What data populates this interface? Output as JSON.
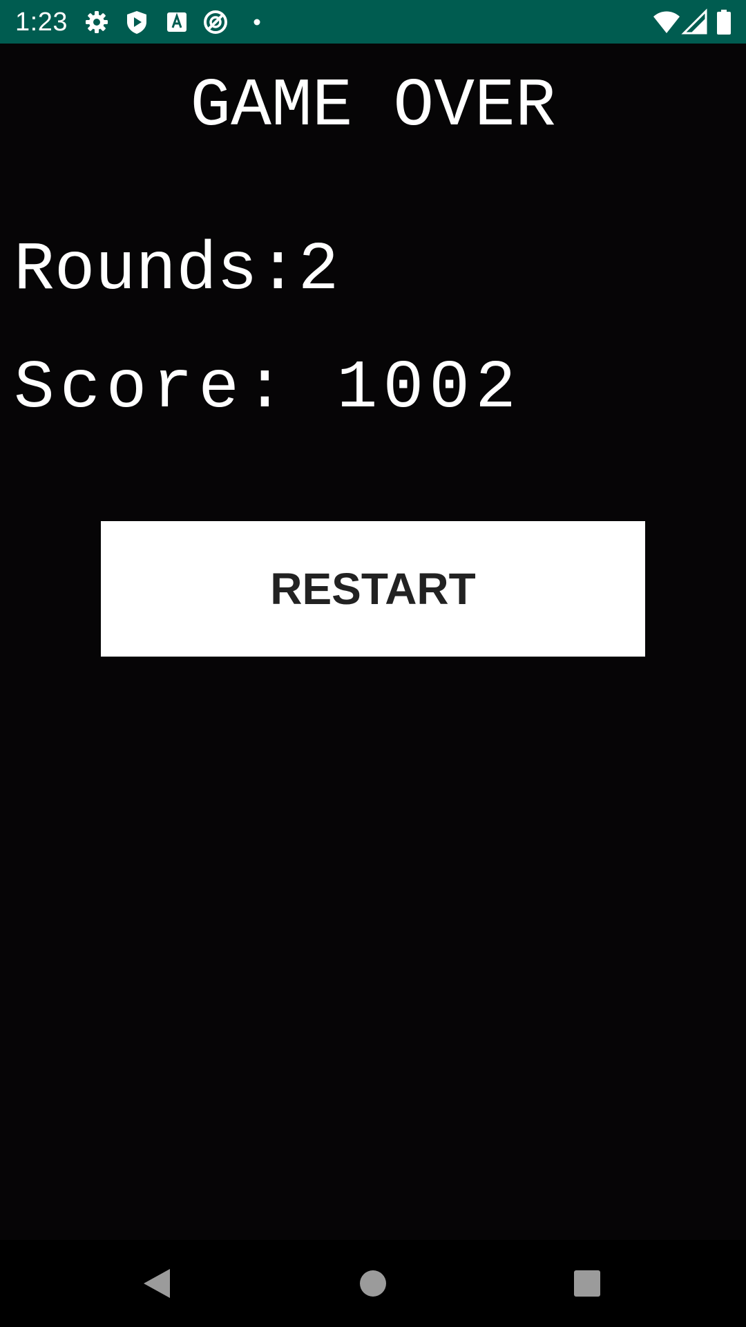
{
  "status_bar": {
    "time": "1:23",
    "background_color": "#005c50",
    "left_icons": [
      "gear-icon",
      "shield-play-icon",
      "accessibility-a-icon",
      "no-disturb-icon",
      "dot-icon"
    ],
    "right_icons": [
      "wifi-icon",
      "cell-signal-icon",
      "battery-icon"
    ]
  },
  "game_over": {
    "title": "GAME OVER",
    "rounds_text": "Rounds:2",
    "score_text": "Score: 1002",
    "restart_label": "RESTART",
    "background_color": "#060506",
    "button_color": "#ffffff"
  },
  "nav_bar": {
    "icons": [
      "back-icon",
      "home-icon",
      "recents-icon"
    ]
  }
}
